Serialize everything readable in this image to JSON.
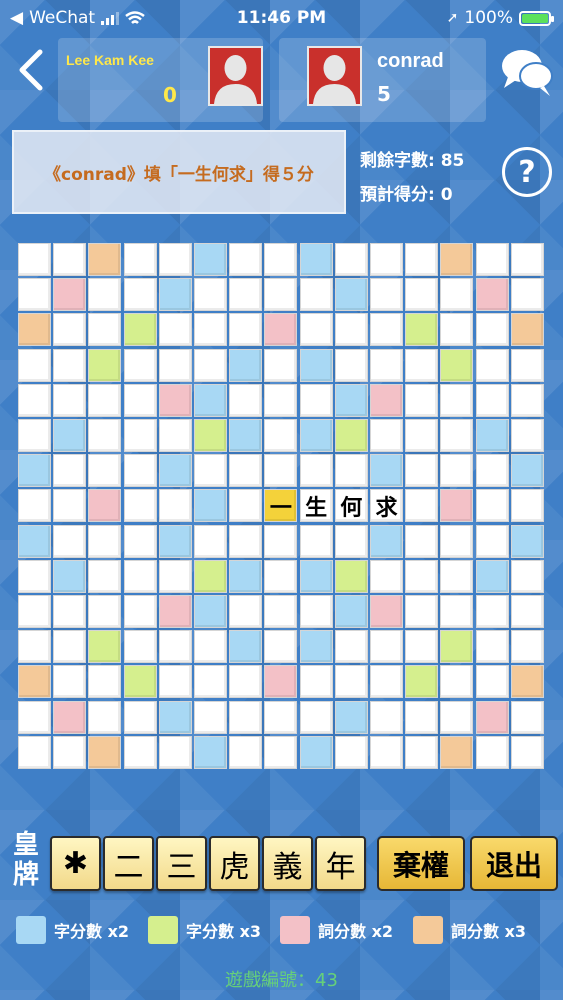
{
  "status_bar": {
    "carrier": "WeChat",
    "time": "11:46 PM",
    "battery": "100%",
    "battery_level": 1.0
  },
  "players": [
    {
      "name": "Lee Kam Kee",
      "score": "0"
    },
    {
      "name": "conrad",
      "score": "5"
    }
  ],
  "message": "《conrad》填「一生何求」得５分",
  "info": {
    "remaining": "剩餘字數: 85",
    "estimate": "預計得分: 0"
  },
  "help_label": "?",
  "board": {
    "size": 15,
    "premium_cells": {
      "dl": [
        [
          0,
          5
        ],
        [
          0,
          8
        ],
        [
          1,
          4
        ],
        [
          1,
          9
        ],
        [
          2,
          7
        ],
        [
          3,
          6
        ],
        [
          3,
          8
        ],
        [
          4,
          5
        ],
        [
          4,
          9
        ],
        [
          5,
          1
        ],
        [
          5,
          6
        ],
        [
          5,
          8
        ],
        [
          5,
          13
        ],
        [
          6,
          0
        ],
        [
          6,
          4
        ],
        [
          6,
          10
        ],
        [
          6,
          14
        ],
        [
          7,
          5
        ],
        [
          7,
          10
        ],
        [
          8,
          0
        ],
        [
          8,
          4
        ],
        [
          8,
          10
        ],
        [
          8,
          14
        ],
        [
          9,
          1
        ],
        [
          9,
          6
        ],
        [
          9,
          8
        ],
        [
          9,
          13
        ],
        [
          10,
          5
        ],
        [
          10,
          9
        ],
        [
          11,
          6
        ],
        [
          11,
          8
        ],
        [
          12,
          7
        ],
        [
          13,
          4
        ],
        [
          13,
          9
        ],
        [
          14,
          5
        ],
        [
          14,
          8
        ]
      ],
      "tl": [
        [
          2,
          3
        ],
        [
          2,
          11
        ],
        [
          3,
          2
        ],
        [
          3,
          12
        ],
        [
          5,
          5
        ],
        [
          5,
          9
        ],
        [
          9,
          5
        ],
        [
          9,
          9
        ],
        [
          11,
          2
        ],
        [
          11,
          12
        ],
        [
          12,
          3
        ],
        [
          12,
          11
        ]
      ],
      "dw": [
        [
          1,
          1
        ],
        [
          1,
          13
        ],
        [
          2,
          7
        ],
        [
          4,
          4
        ],
        [
          4,
          10
        ],
        [
          7,
          2
        ],
        [
          7,
          12
        ],
        [
          10,
          4
        ],
        [
          10,
          10
        ],
        [
          12,
          7
        ],
        [
          13,
          1
        ],
        [
          13,
          13
        ]
      ],
      "tw": [
        [
          0,
          2
        ],
        [
          0,
          12
        ],
        [
          2,
          0
        ],
        [
          2,
          14
        ],
        [
          12,
          0
        ],
        [
          12,
          14
        ],
        [
          14,
          2
        ],
        [
          14,
          12
        ]
      ]
    },
    "tiles": [
      {
        "row": 7,
        "col": 7,
        "char": "一",
        "highlight": true
      },
      {
        "row": 7,
        "col": 8,
        "char": "生",
        "highlight": false
      },
      {
        "row": 7,
        "col": 9,
        "char": "何",
        "highlight": false
      },
      {
        "row": 7,
        "col": 10,
        "char": "求",
        "highlight": false
      }
    ]
  },
  "rack": {
    "label": "皇牌",
    "tiles": [
      "✱",
      "二",
      "三",
      "虎",
      "義",
      "年"
    ],
    "buttons": {
      "pass": "棄權",
      "quit": "退出"
    }
  },
  "legend": [
    {
      "label": "字分數 x2",
      "color": "#a8d8f4"
    },
    {
      "label": "字分數 x3",
      "color": "#d5ef8e"
    },
    {
      "label": "詞分數 x2",
      "color": "#f3c1c7"
    },
    {
      "label": "詞分數 x3",
      "color": "#f4c999"
    }
  ],
  "game_id": "遊戲編號：43"
}
